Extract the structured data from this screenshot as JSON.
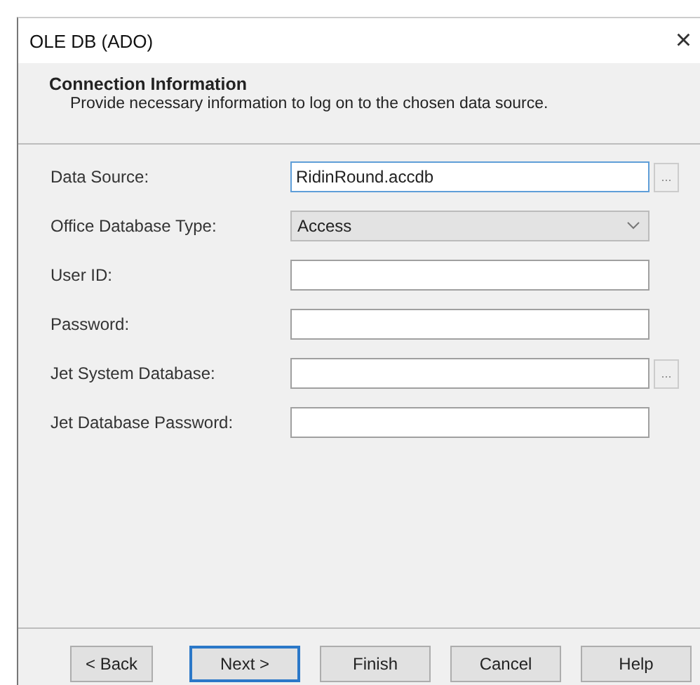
{
  "window": {
    "title": "OLE DB (ADO)",
    "close": "×"
  },
  "header": {
    "title": "Connection Information",
    "subtitle": "Provide necessary information to log on to the chosen data source."
  },
  "fields": [
    {
      "kind": "text",
      "label": "Data Source:",
      "value": "RidinRound.accdb",
      "focused": true,
      "browse": "..."
    },
    {
      "kind": "combo",
      "label": "Office Database Type:",
      "value": "Access"
    },
    {
      "kind": "text",
      "label": "User ID:",
      "focused": false
    },
    {
      "kind": "text",
      "label": "Password:",
      "focused": false
    },
    {
      "kind": "text",
      "label": "Jet System Database:",
      "focused": false,
      "browse": "..."
    },
    {
      "kind": "text",
      "label": "Jet Database Password:",
      "focused": false
    }
  ],
  "buttons": [
    {
      "label": "< Back",
      "default": false
    },
    {
      "label": "Next >",
      "default": true
    },
    {
      "label": "Finish",
      "default": false
    },
    {
      "label": "Cancel",
      "default": false
    },
    {
      "label": "Help",
      "default": false
    }
  ]
}
